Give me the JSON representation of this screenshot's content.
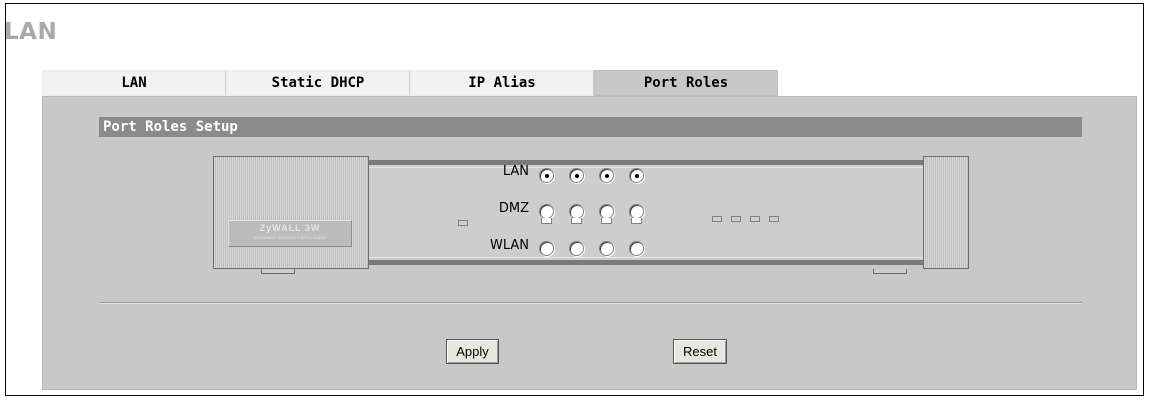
{
  "page": {
    "title": "LAN"
  },
  "tabs": [
    {
      "label": "LAN",
      "active": false
    },
    {
      "label": "Static DHCP",
      "active": false
    },
    {
      "label": "IP Alias",
      "active": false
    },
    {
      "label": "Port Roles",
      "active": true
    }
  ],
  "section": {
    "title": "Port Roles Setup"
  },
  "device": {
    "logo_text": "ZyWALL 3W",
    "logo_subtext": "INTERNET SECURITY APPLIANCE"
  },
  "port_roles": {
    "rows": [
      {
        "label": "LAN",
        "selected": [
          true,
          true,
          true,
          true
        ]
      },
      {
        "label": "DMZ",
        "selected": [
          false,
          false,
          false,
          false
        ]
      },
      {
        "label": "WLAN",
        "selected": [
          false,
          false,
          false,
          false
        ]
      }
    ]
  },
  "buttons": {
    "apply": "Apply",
    "reset": "Reset"
  },
  "colors": {
    "tab_active": "#c9c8c8",
    "tab_inactive": "#f1f1f1",
    "panel": "#c9c8c8",
    "section_bar": "#8c8b8c",
    "title": "#a9a9a9"
  }
}
